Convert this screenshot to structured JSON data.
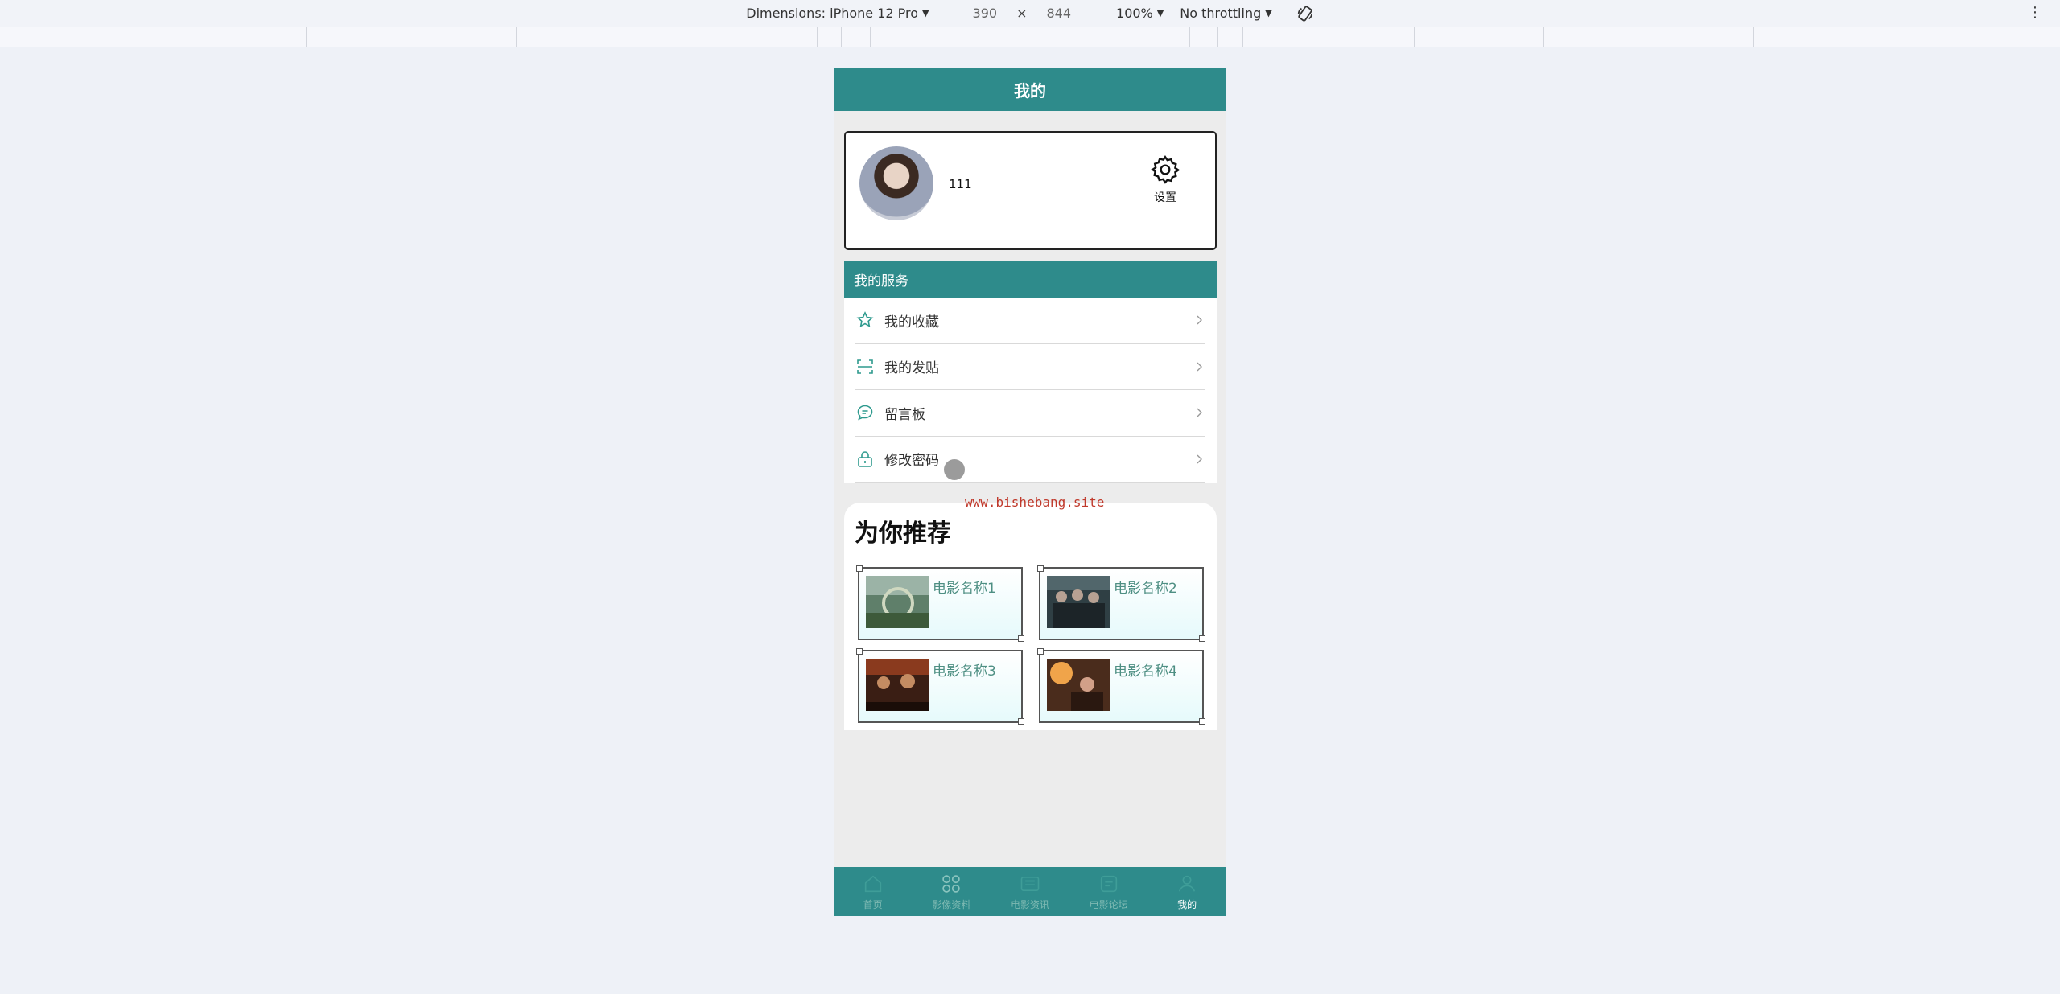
{
  "devtools": {
    "dimensions_label": "Dimensions: iPhone 12 Pro",
    "width": "390",
    "times": "×",
    "height": "844",
    "zoom": "100%",
    "throttle": "No throttling",
    "menu_icon": "more-vertical-icon",
    "rotate_icon": "rotate-icon"
  },
  "app": {
    "title": "我的",
    "profile": {
      "username": "111",
      "settings_label": "设置",
      "settings_icon": "gear-icon"
    },
    "services": {
      "title": "我的服务",
      "items": [
        {
          "label": "我的收藏",
          "icon": "star-icon"
        },
        {
          "label": "我的发贴",
          "icon": "scan-icon"
        },
        {
          "label": "留言板",
          "icon": "message-icon"
        },
        {
          "label": "修改密码",
          "icon": "lock-icon"
        }
      ]
    },
    "watermark": "www.bishebang.site",
    "recommend": {
      "title": "为你推荐",
      "movies": [
        {
          "name": "电影名称1"
        },
        {
          "name": "电影名称2"
        },
        {
          "name": "电影名称3"
        },
        {
          "name": "电影名称4"
        }
      ]
    },
    "tabs": [
      {
        "label": "首页",
        "icon": "home-icon",
        "active": false
      },
      {
        "label": "影像资料",
        "icon": "grid-icon",
        "active": false
      },
      {
        "label": "电影资讯",
        "icon": "news-icon",
        "active": false
      },
      {
        "label": "电影论坛",
        "icon": "forum-icon",
        "active": false
      },
      {
        "label": "我的",
        "icon": "user-icon",
        "active": true
      }
    ],
    "colors": {
      "primary": "#2e8b8b",
      "movie_name": "#4e8f83",
      "watermark": "#c0392b"
    }
  }
}
